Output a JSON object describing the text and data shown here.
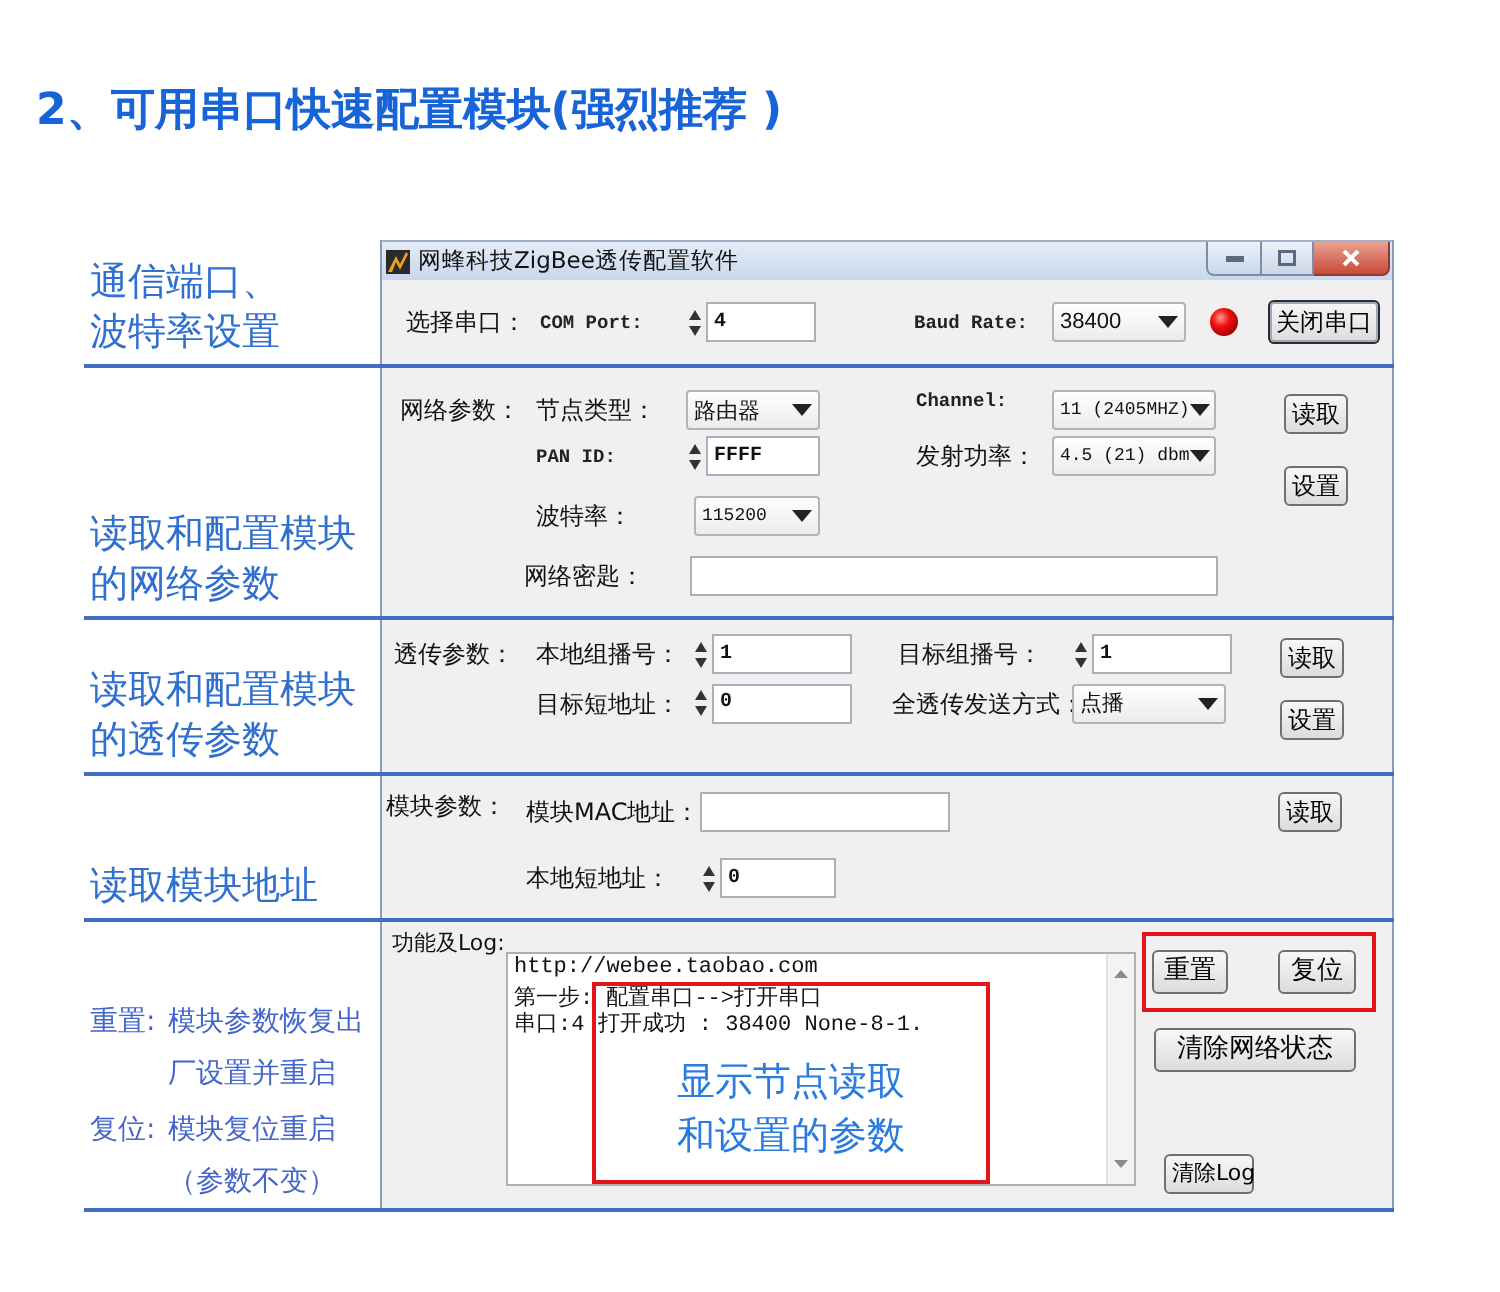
{
  "heading": "2、可用串口快速配置模块(强烈推荐 )",
  "window": {
    "title": "网蜂科技ZigBee透传配置软件"
  },
  "port": {
    "callout": [
      "通信端口、",
      "波特率设置"
    ],
    "label": "选择串口：",
    "com_port": {
      "label": "COM Port:",
      "value": "4"
    },
    "baud_rate": {
      "label": "Baud Rate:",
      "value": "38400"
    },
    "open": true,
    "button": "关闭串口"
  },
  "network": {
    "callout": [
      "读取和配置模块",
      "的网络参数"
    ],
    "label": "网络参数：",
    "node_type": {
      "label": "节点类型：",
      "value": "路由器"
    },
    "channel": {
      "label": "Channel:",
      "value": "11 (2405MHZ)"
    },
    "pan_id": {
      "label": "PAN ID:",
      "value": "FFFF"
    },
    "tx_power": {
      "label": "发射功率：",
      "value": "4.5 (21) dbm"
    },
    "baud_rate": {
      "label": "波特率：",
      "value": "115200"
    },
    "network_key": {
      "label": "网络密匙："
    },
    "buttons": [
      "读取",
      "设置"
    ]
  },
  "passthrough": {
    "callout": [
      "读取和配置模块",
      "的透传参数"
    ],
    "label": "透传参数：",
    "local_group": {
      "label": "本地组播号：",
      "value": "1"
    },
    "target_group": {
      "label": "目标组播号：",
      "value": "1"
    },
    "target_address": {
      "label": "目标短地址：",
      "value": "0"
    },
    "send_mode": {
      "label": "全透传发送方式：",
      "value": "点播"
    },
    "buttons": [
      "读取",
      "设置"
    ]
  },
  "module": {
    "callout": [
      "读取模块地址"
    ],
    "label": "模块参数：",
    "mac_address": {
      "label": "模块MAC地址："
    },
    "short_address": {
      "label": "本地短地址：",
      "value": "0"
    },
    "buttons": [
      "读取"
    ]
  },
  "log": {
    "notes": [
      {
        "term": "重置:",
        "lines": [
          "模块参数恢复出",
          "厂设置并重启"
        ]
      },
      {
        "term": "复位:",
        "lines": [
          "模块复位重启",
          "（参数不变）"
        ]
      }
    ],
    "label": "功能及Log:",
    "lines": [
      "http://webee.taobao.com",
      "第一步: 配置串口-->打开串口",
      "串口:4 打开成功 : 38400 None-8-1."
    ],
    "callout": [
      "显示节点读取",
      "和设置的参数"
    ],
    "action_buttons": [
      "重置",
      "复位"
    ],
    "clear_network_button": "清除网络状态",
    "clear_log_button": "清除Log"
  }
}
